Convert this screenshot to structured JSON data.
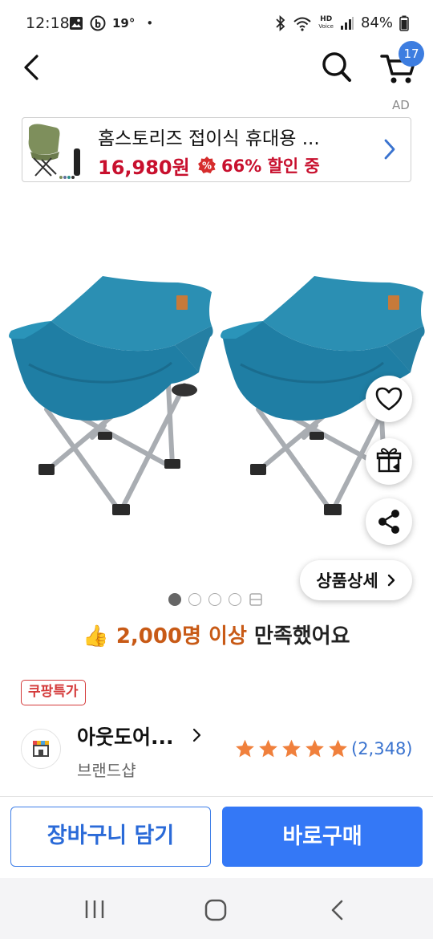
{
  "status_bar": {
    "time": "12:18",
    "temperature": "19°",
    "dot": "•",
    "hd_top": "HD",
    "hd_bottom": "Voice",
    "battery_pct": "84%"
  },
  "header": {
    "cart_count": "17"
  },
  "ad": {
    "label": "AD",
    "title": "홈스토리즈 접이식 휴대용 ...",
    "price": "16,980원",
    "discount_text": "66% 할인 중"
  },
  "product": {
    "image_pages_total": 5,
    "active_page": 1,
    "detail_button_label": "상품상세"
  },
  "satisfaction": {
    "emoji": "👍",
    "highlight": "2,000명 이상",
    "rest": "만족했어요"
  },
  "badge": {
    "label": "쿠팡특가"
  },
  "brand": {
    "name": "아웃도어...",
    "shop_label": "브랜드샵",
    "rating_stars": 5,
    "rating_count": "(2,348)"
  },
  "actions": {
    "add_to_cart": "장바구니 담기",
    "buy_now": "바로구매"
  },
  "colors": {
    "accent_blue": "#3478f6",
    "price_red": "#c8102e",
    "star_orange": "#f0803c",
    "highlight_orange": "#c85a16",
    "chair_blue": "#2b8fb3"
  }
}
